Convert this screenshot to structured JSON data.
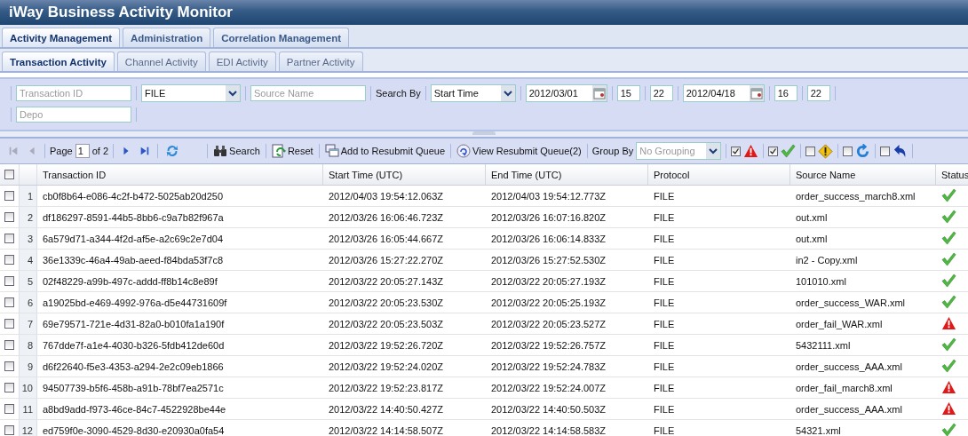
{
  "app_title": "iWay Business Activity Monitor",
  "main_tabs": [
    {
      "label": "Activity Management",
      "selected": true
    },
    {
      "label": "Administration",
      "selected": false
    },
    {
      "label": "Correlation Management",
      "selected": false
    }
  ],
  "sub_tabs": [
    {
      "label": "Transaction Activity",
      "selected": true
    },
    {
      "label": "Channel Activity",
      "selected": false
    },
    {
      "label": "EDI Activity",
      "selected": false
    },
    {
      "label": "Partner Activity",
      "selected": false
    }
  ],
  "filters": [
    [
      {
        "kind": "text",
        "placeholder": "Transaction ID"
      },
      {
        "kind": "select",
        "value": "FILE"
      },
      {
        "kind": "text",
        "placeholder": "Source Name"
      },
      {
        "kind": "label",
        "text": "Search By"
      },
      {
        "kind": "select",
        "value": "Start Time"
      },
      {
        "kind": "date",
        "value": "2012/03/01"
      },
      {
        "kind": "number",
        "value": "15"
      },
      {
        "kind": "number",
        "value": "22"
      },
      {
        "kind": "date",
        "value": "2012/04/18"
      },
      {
        "kind": "number",
        "value": "16"
      },
      {
        "kind": "number",
        "value": "22"
      }
    ],
    [
      {
        "kind": "text",
        "placeholder": "Depo"
      }
    ]
  ],
  "toolbar": {
    "page_label": "Page",
    "page": "1",
    "page_total": "of 2",
    "buttons": [
      {
        "kind": "search",
        "label": "Search"
      },
      {
        "kind": "reset",
        "label": "Reset"
      },
      {
        "kind": "add",
        "label": "Add to Resubmit Queue"
      },
      {
        "kind": "view",
        "label": "View Resubmit Queue(2)"
      }
    ],
    "group_by_label": "Group By",
    "group_by": {
      "placeholder": "No Grouping"
    },
    "status_filters": [
      {
        "kind": "error",
        "checked": true
      },
      {
        "kind": "success",
        "checked": true
      },
      {
        "kind": "warning",
        "checked": false
      },
      {
        "kind": "retry",
        "checked": false
      },
      {
        "kind": "back",
        "checked": false
      }
    ]
  },
  "table": {
    "select_all": false,
    "columns": [
      "Transaction ID",
      "Start Time (UTC)",
      "End Time (UTC)",
      "Protocol",
      "Source Name",
      "Status"
    ],
    "rows": [
      {
        "checked": false,
        "number": "1",
        "id": "cb0f8b64-e086-4c2f-b472-5025ab20d250",
        "start": "2012/04/03 19:54:12.063Z",
        "end": "2012/04/03 19:54:12.773Z",
        "protocol": "FILE",
        "source": "order_success_march8.xml",
        "kind": "success"
      },
      {
        "checked": false,
        "number": "2",
        "id": "df186297-8591-44b5-8bb6-c9a7b82f967a",
        "start": "2012/03/26 16:06:46.723Z",
        "end": "2012/03/26 16:07:16.820Z",
        "protocol": "FILE",
        "source": "out.xml",
        "kind": "success"
      },
      {
        "checked": false,
        "number": "3",
        "id": "6a579d71-a344-4f2d-af5e-a2c69c2e7d04",
        "start": "2012/03/26 16:05:44.667Z",
        "end": "2012/03/26 16:06:14.833Z",
        "protocol": "FILE",
        "source": "out.xml",
        "kind": "success"
      },
      {
        "checked": false,
        "number": "4",
        "id": "36e1339c-46a4-49ab-aeed-f84bda53f7c8",
        "start": "2012/03/26 15:27:22.270Z",
        "end": "2012/03/26 15:27:52.530Z",
        "protocol": "FILE",
        "source": "in2 - Copy.xml",
        "kind": "success"
      },
      {
        "checked": false,
        "number": "5",
        "id": "02f48229-a99b-497c-addd-ff8b14c8e89f",
        "start": "2012/03/22 20:05:27.143Z",
        "end": "2012/03/22 20:05:27.193Z",
        "protocol": "FILE",
        "source": "101010.xml",
        "kind": "success"
      },
      {
        "checked": false,
        "number": "6",
        "id": "a19025bd-e469-4992-976a-d5e44731609f",
        "start": "2012/03/22 20:05:23.530Z",
        "end": "2012/03/22 20:05:25.193Z",
        "protocol": "FILE",
        "source": "order_success_WAR.xml",
        "kind": "success"
      },
      {
        "checked": false,
        "number": "7",
        "id": "69e79571-721e-4d31-82a0-b010fa1a190f",
        "start": "2012/03/22 20:05:23.503Z",
        "end": "2012/03/22 20:05:23.527Z",
        "protocol": "FILE",
        "source": "order_fail_WAR.xml",
        "kind": "error"
      },
      {
        "checked": false,
        "number": "8",
        "id": "767dde7f-a1e4-4030-b326-5fdb412de60d",
        "start": "2012/03/22 19:52:26.720Z",
        "end": "2012/03/22 19:52:26.757Z",
        "protocol": "FILE",
        "source": "5432111.xml",
        "kind": "success"
      },
      {
        "checked": false,
        "number": "9",
        "id": "d6f22640-f5e3-4353-a294-2e2c09eb1866",
        "start": "2012/03/22 19:52:24.020Z",
        "end": "2012/03/22 19:52:24.783Z",
        "protocol": "FILE",
        "source": "order_success_AAA.xml",
        "kind": "success"
      },
      {
        "checked": false,
        "number": "10",
        "id": "94507739-b5f6-458b-a91b-78bf7ea2571c",
        "start": "2012/03/22 19:52:23.817Z",
        "end": "2012/03/22 19:52:24.007Z",
        "protocol": "FILE",
        "source": "order_fail_march8.xml",
        "kind": "error"
      },
      {
        "checked": false,
        "number": "11",
        "id": "a8bd9add-f973-46ce-84c7-4522928be44e",
        "start": "2012/03/22 14:40:50.427Z",
        "end": "2012/03/22 14:40:50.503Z",
        "protocol": "FILE",
        "source": "order_success_AAA.xml",
        "kind": "error"
      },
      {
        "checked": false,
        "number": "12",
        "id": "ed759f0e-3090-4529-8d30-e20930a0fa54",
        "start": "2012/03/22 14:14:58.507Z",
        "end": "2012/03/22 14:14:58.583Z",
        "protocol": "FILE",
        "source": "54321.xml",
        "kind": "success"
      }
    ]
  }
}
